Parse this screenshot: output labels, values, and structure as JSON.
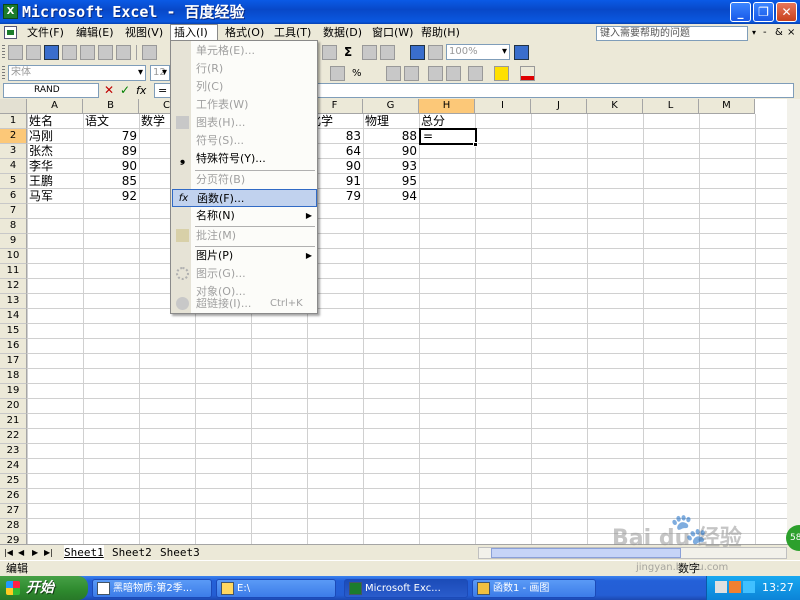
{
  "window": {
    "title": "Microsoft Excel - 百度经验",
    "minimize": "_",
    "restore": "❐",
    "close": "✕"
  },
  "menubar": {
    "items": [
      "文件(F)",
      "编辑(E)",
      "视图(V)",
      "插入(I)",
      "格式(O)",
      "工具(T)",
      "数据(D)",
      "窗口(W)",
      "帮助(H)"
    ],
    "help_placeholder": "键入需要帮助的问题",
    "mdi_minimize": "-",
    "mdi_restore": "&",
    "mdi_close": "×"
  },
  "toolbar": {
    "font": "宋体",
    "font_size": "12",
    "zoom": "100%",
    "sigma": "Σ",
    "percent": "%"
  },
  "formula_bar": {
    "name_box": "RAND",
    "cancel": "✕",
    "enter": "✓",
    "fx": "fx",
    "content": "="
  },
  "grid": {
    "columns": [
      "A",
      "B",
      "C",
      "D",
      "E",
      "F",
      "G",
      "H",
      "I",
      "J",
      "K",
      "L",
      "M"
    ],
    "rows": [
      "1",
      "2",
      "3",
      "4",
      "5",
      "6",
      "7",
      "8",
      "9",
      "10",
      "11",
      "12",
      "13",
      "14",
      "15",
      "16",
      "17",
      "18",
      "19",
      "20",
      "21",
      "22",
      "23",
      "24",
      "25",
      "26",
      "27",
      "28",
      "29"
    ],
    "headers_row": {
      "A": "姓名",
      "B": "语文",
      "C": "数学",
      "F": "化学",
      "G": "物理",
      "H": "总分"
    },
    "data_rows": [
      {
        "name": "冯刚",
        "chinese": "79",
        "chemistry": "83",
        "physics": "88"
      },
      {
        "name": "张杰",
        "chinese": "89",
        "chemistry": "64",
        "physics": "90"
      },
      {
        "name": "李华",
        "chinese": "90",
        "chemistry": "90",
        "physics": "93"
      },
      {
        "name": "王鹏",
        "chinese": "85",
        "chemistry": "91",
        "physics": "95"
      },
      {
        "name": "马军",
        "chinese": "92",
        "chemistry": "79",
        "physics": "94"
      }
    ],
    "active_cell_value": "="
  },
  "insert_menu": {
    "items": [
      {
        "label": "单元格(E)...",
        "disabled": true
      },
      {
        "label": "行(R)",
        "disabled": true
      },
      {
        "label": "列(C)",
        "disabled": true
      },
      {
        "label": "工作表(W)",
        "disabled": true
      },
      {
        "label": "图表(H)...",
        "disabled": true
      },
      {
        "label": "符号(S)...",
        "disabled": true
      },
      {
        "label": "特殊符号(Y)...",
        "disabled": false
      },
      {
        "label": "分页符(B)",
        "disabled": true
      },
      {
        "label": "函数(F)...",
        "disabled": false
      },
      {
        "label": "名称(N)",
        "disabled": false
      },
      {
        "label": "批注(M)",
        "disabled": true
      },
      {
        "label": "图片(P)",
        "disabled": false
      },
      {
        "label": "图示(G)...",
        "disabled": true
      },
      {
        "label": "对象(O)...",
        "disabled": true
      },
      {
        "label": "超链接(I)...",
        "disabled": true
      }
    ],
    "hyperlink_shortcut": "Ctrl+K",
    "function_icon": "fx",
    "symbol_icon": "❟",
    "arrow": "▶"
  },
  "sheets": {
    "tabs": [
      "Sheet1",
      "Sheet2",
      "Sheet3"
    ],
    "nav": [
      "|◀",
      "◀",
      "▶",
      "▶|"
    ]
  },
  "status": {
    "mode": "编辑",
    "right": "数字"
  },
  "taskbar": {
    "start": "开始",
    "tasks": [
      "黑暗物质:第2季...",
      "E:\\",
      "Microsoft Exc...",
      "函数1 - 画图"
    ],
    "clock": "13:27"
  },
  "watermark": {
    "text": "Bai du 经验",
    "sub": "jingyan.baidu.com",
    "badge": "58"
  }
}
